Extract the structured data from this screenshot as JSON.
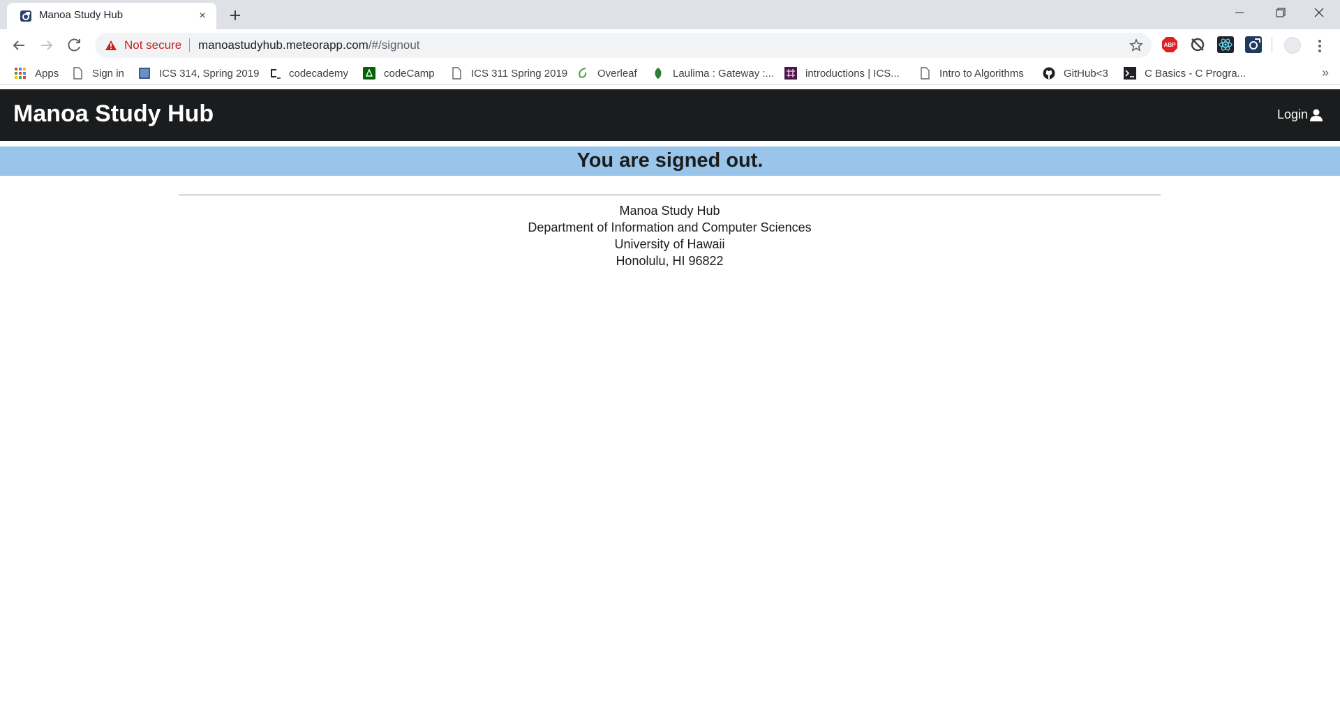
{
  "browser": {
    "tab": {
      "title": "Manoa Study Hub",
      "close": "×"
    },
    "security_label": "Not secure",
    "url": {
      "host": "manoastudyhub.meteorapp.com",
      "path": "/#/signout"
    },
    "extensions": [
      "adblock-icon",
      "sync-icon",
      "react-devtools-icon",
      "meteor-devtools-icon"
    ],
    "bookmarks": [
      {
        "label": "Apps",
        "icon": "apps-grid-icon"
      },
      {
        "label": "Sign in",
        "icon": "page-icon"
      },
      {
        "label": "ICS 314, Spring 2019",
        "icon": "square-site-icon"
      },
      {
        "label": "codecademy",
        "icon": "codecademy-icon"
      },
      {
        "label": "codeCamp",
        "icon": "freecodecamp-icon"
      },
      {
        "label": "ICS 311 Spring 2019",
        "icon": "page-icon"
      },
      {
        "label": "Overleaf",
        "icon": "overleaf-icon"
      },
      {
        "label": "Laulima : Gateway :...",
        "icon": "laulima-icon"
      },
      {
        "label": "introductions | ICS...",
        "icon": "slack-icon"
      },
      {
        "label": "Intro to Algorithms",
        "icon": "page-icon"
      },
      {
        "label": "GitHub<3",
        "icon": "github-icon"
      },
      {
        "label": "C Basics - C Progra...",
        "icon": "terminal-icon"
      }
    ],
    "bookmarks_more": "»"
  },
  "page": {
    "brand": "Manoa Study Hub",
    "login_label": "Login",
    "banner": "You are signed out.",
    "footer": {
      "line1": "Manoa Study Hub",
      "line2": "Department of Information and Computer Sciences",
      "line3": "University of Hawaii",
      "line4": "Honolulu, HI 96822"
    }
  },
  "colors": {
    "navbar": "#1b1c1d",
    "banner": "#98c5e9",
    "not_secure": "#c5221f"
  }
}
